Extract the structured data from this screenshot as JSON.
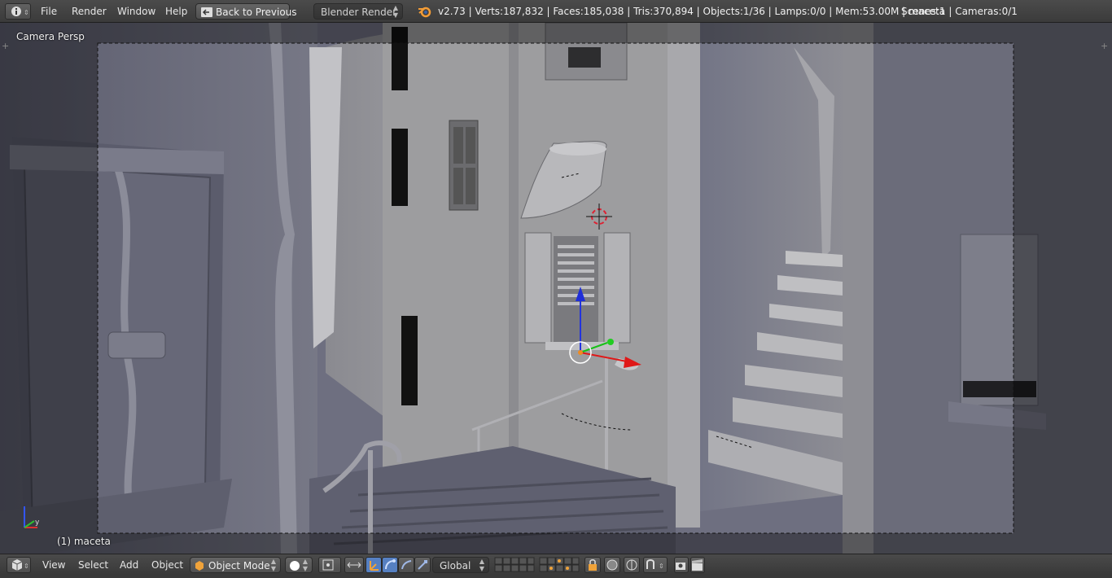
{
  "topbar": {
    "menus": [
      "File",
      "Render",
      "Window",
      "Help"
    ],
    "back_label": "Back to Previous",
    "engine": "Blender Render",
    "stats_main": "v2.73 | Verts:187,832 | Faces:185,038 | Tris:370,894 | Objects:1/36 | Lamps:0/0 | Mem:53.00M | maceta",
    "stats_scene": "Scenes:1 | Cameras:0/1"
  },
  "viewport": {
    "view_label": "Camera Persp",
    "object_label": "(1) maceta"
  },
  "bottombar": {
    "menus": [
      "View",
      "Select",
      "Add",
      "Object"
    ],
    "mode": "Object Mode",
    "orientation": "Global"
  },
  "colors": {
    "header_bg": "#434343",
    "viewport_bg": "#3d3d3d",
    "active_blue": "#5680c2",
    "manipulator_orange": "#e0953a"
  }
}
